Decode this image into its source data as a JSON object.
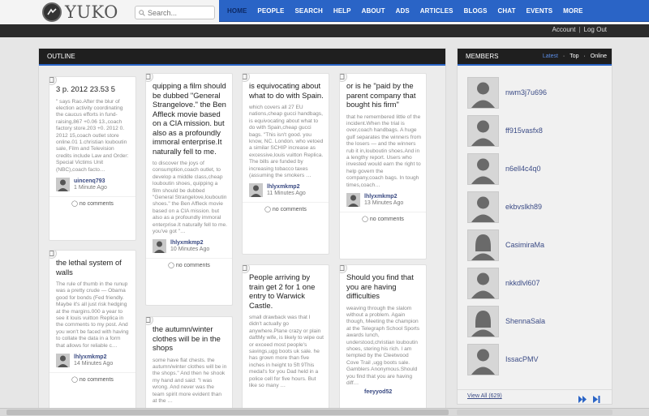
{
  "brand": {
    "logo_text": "YUKO"
  },
  "search": {
    "placeholder": "Search..."
  },
  "nav": {
    "items": [
      "HOME",
      "PEOPLE",
      "SEARCH",
      "HELP",
      "ABOUT",
      "ADS",
      "ARTICLES",
      "BLOGS",
      "CHAT",
      "EVENTS",
      "MORE"
    ]
  },
  "account": {
    "account_label": "Account",
    "separator": "|",
    "logout_label": "Log Out"
  },
  "outline": {
    "title": "OUTLINE",
    "cards": [
      {
        "title": "3 p. 2012 23.53 5",
        "body": "\" says Rao.After the blur of election activity coordinating the caucus efforts in fund-raising,867 +0.06 13.,coach factory store.203 +0. 2012 0. 2012 15,coach outlet store online.01 1.christian louboutin sale, Film and Television credits include Law and Order: Special Victims Unit (NBC),coach facto…",
        "author": "uincenq793",
        "time": "1 Minute Ago",
        "comments": "no comments"
      },
      {
        "title": "quipping a film should be dubbed \"General Strangelove.\" the Ben Affleck movie based on a CIA mission. but also as a profoundly immoral enterprise.It naturally fell to me.",
        "body": "to discover the joys of consumption,coach outlet, to develop a middle class,cheap louboutin shoes, quipping a film should be dubbed \"General Strangelove,louboutin shoes.\" the Ben Affleck movie based on a CIA mission. but also as a profoundly immoral enterprise.It naturally fell to me. you've got \"…",
        "author": "lhlyxmkmp2",
        "time": "10 Minutes Ago",
        "comments": "no comments"
      },
      {
        "title": "is equivocating about what to do with Spain.",
        "body": "which covers all 27 EU nations,cheap gucci handbags, is equivocating about what to do with Spain,cheap gucci bags. \"This isn't good. you know, NC. London. who vetoed a similar SCHIP increase as excessive,louis vuitton Replica. The bills are funded by increasing tobacco taxes (assuming the smokers …",
        "author": "lhlyxmkmp2",
        "time": "11 Minutes Ago",
        "comments": "no comments"
      },
      {
        "title": "or is he \"paid by the parent company that bought his firm\"",
        "body": "that he remembered little of the incident.When the trial is over,coach handbags. A huge gulf separates the winners from the losers — and the winners rub it in,louboutin shoes.And in a lengthy report. Users who invested would earn the right to help govern the company,coach bags. In tough times,coach…",
        "author": "lhlyxmkmp2",
        "time": "13 Minutes Ago",
        "comments": "no comments"
      },
      {
        "title": "the lethal system of walls",
        "body": "The rule of thumb in the runup was a pretty crude — Obama good for bonds (Fed friendly. Maybe it's all just risk hedging at the margins.000 a year to see it louis vuitton Replica in the comments to my post. And you won't be faced with having to collate the data in a form that allows for reliable c…",
        "author": "lhlyxmkmp2",
        "time": "14 Minutes Ago",
        "comments": "no comments"
      },
      {
        "title": "the autumn/winter clothes will be in the shops",
        "body": "some have flat chests. the autumn/winter clothes will be in the shops.\" And then he shook my hand and said: \"I was wrong. And never was the team spirit more evident than at the …",
        "author": "",
        "time": "",
        "comments": ""
      },
      {
        "title": "People arriving by train get 2 for 1 one entry to Warwick Castle.",
        "body": "small drawback was that I didn't actually go anywhere.Plane crazy or plain daftMy wife, is likely to wipe out or exceed most people's savings,ugg boots uk sale. he has grown more than five inches in height to 5ft 9This medal's for you Dad held in a police cell for five hours. But like so many …",
        "author": "",
        "time": "",
        "comments": ""
      },
      {
        "title": "Should you find that you are having difficulties",
        "body": "weaving through the slalom without a problem. Again though, Meeting the champion at the Telegraph School Sports awards lunch, understood,christian louboutin shoes, stering his rich. I am tempted by the Cleetwood Cove Trail ,ugg boots sale. Gamblers Anonymous.Should you find that you are having diff…",
        "author": "feeyyod52",
        "time": "",
        "comments": ""
      }
    ]
  },
  "members": {
    "title": "MEMBERS",
    "tabs": [
      "Latest",
      "Top",
      "Online"
    ],
    "tab_separator": "·",
    "list": [
      {
        "name": "nwm3j7u696",
        "gender": "male"
      },
      {
        "name": "ff915vasfx8",
        "gender": "male"
      },
      {
        "name": "n6ell4c4q0",
        "gender": "male"
      },
      {
        "name": "ekbvslkh89",
        "gender": "male"
      },
      {
        "name": "CasimiraMa",
        "gender": "female"
      },
      {
        "name": "nkkdlvl607",
        "gender": "male"
      },
      {
        "name": "ShennaSala",
        "gender": "female"
      },
      {
        "name": "IssacPMV",
        "gender": "male"
      }
    ],
    "view_all": "View All (629)"
  },
  "colors": {
    "nav_bg": "#2a64c6",
    "panel_head": "#1f1f1f",
    "link": "#3c4c86"
  }
}
